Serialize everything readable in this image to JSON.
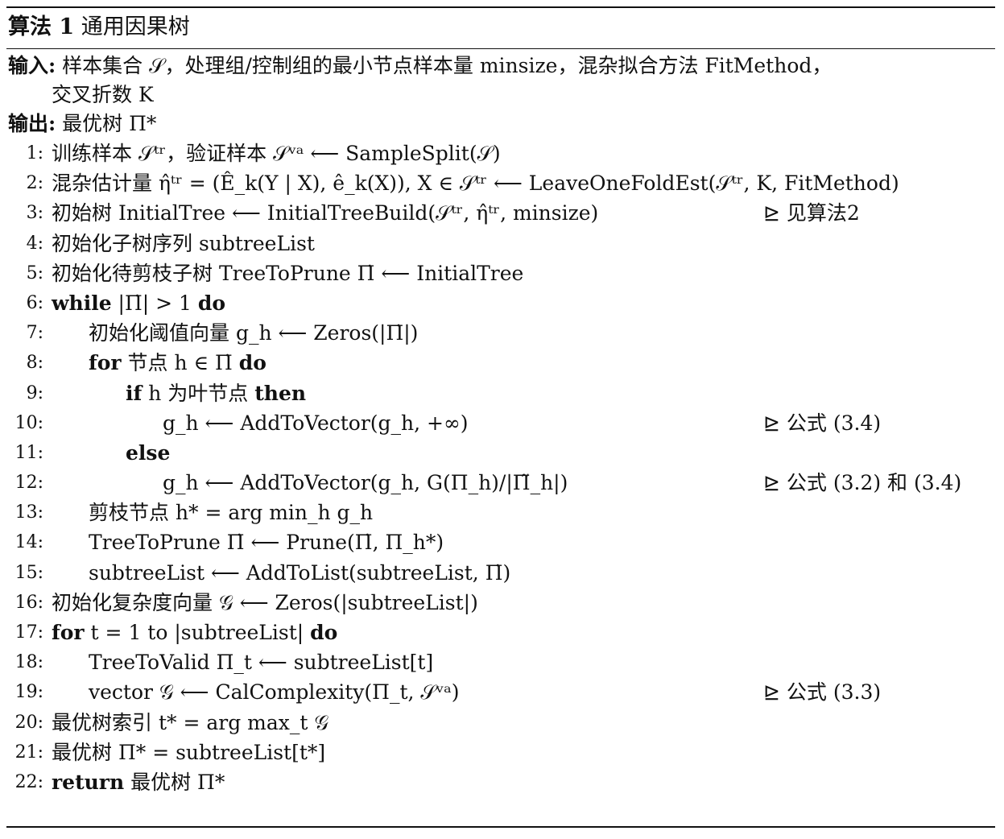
{
  "caption": {
    "label": "算法 1",
    "title": "通用因果树"
  },
  "input": {
    "label": "输入:",
    "text": " 样本集合 𝒮，处理组/控制组的最小节点样本量 minsize，混杂拟合方法 FitMethod，",
    "text_cont": "交叉折数 K"
  },
  "output": {
    "label": "输出:",
    "text": " 最优树 Π*"
  },
  "lines": [
    {
      "num": "1:",
      "indent": 0,
      "kw": "",
      "text": "训练样本 𝒮ᵗʳ，验证样本 𝒮ᵛᵃ ⟵ SampleSplit(𝒮)",
      "comment": ""
    },
    {
      "num": "2:",
      "indent": 0,
      "kw": "",
      "text": "混杂估计量 η̂ᵗʳ = (Ê_k(Y | X), ê_k(X)), X ∈ 𝒮ᵗʳ ⟵ LeaveOneFoldEst(𝒮ᵗʳ, K, FitMethod)",
      "comment": ""
    },
    {
      "num": "3:",
      "indent": 0,
      "kw": "",
      "text": "初始树 InitialTree ⟵ InitialTreeBuild(𝒮ᵗʳ, η̂ᵗʳ, minsize)",
      "comment": "⊵ 见算法2"
    },
    {
      "num": "4:",
      "indent": 0,
      "kw": "",
      "text": "初始化子树序列 subtreeList",
      "comment": ""
    },
    {
      "num": "5:",
      "indent": 0,
      "kw": "",
      "text": "初始化待剪枝子树 TreeToPrune Π̇ ⟵ InitialTree",
      "comment": ""
    },
    {
      "num": "6:",
      "indent": 0,
      "kw": "while",
      "text": " |Π̇| > 1 ",
      "kw2": "do",
      "comment": ""
    },
    {
      "num": "7:",
      "indent": 1,
      "kw": "",
      "text": "初始化阈值向量 g_h ⟵ Zeros(|Π̇|)",
      "comment": ""
    },
    {
      "num": "8:",
      "indent": 1,
      "kw": "for",
      "text": " 节点 h ∈ Π̇ ",
      "kw2": "do",
      "comment": ""
    },
    {
      "num": "9:",
      "indent": 2,
      "kw": "if",
      "text": " h 为叶节点 ",
      "kw2": "then",
      "comment": ""
    },
    {
      "num": "10:",
      "indent": 3,
      "kw": "",
      "text": "g_h ⟵ AddToVector(g_h, +∞)",
      "comment": "⊵ 公式 (3.4)"
    },
    {
      "num": "11:",
      "indent": 2,
      "kw": "else",
      "text": "",
      "comment": ""
    },
    {
      "num": "12:",
      "indent": 3,
      "kw": "",
      "text": "g_h ⟵ AddToVector(g_h, G(Π_h)/|Π̃_h|)",
      "comment": "⊵ 公式 (3.2) 和 (3.4)"
    },
    {
      "num": "13:",
      "indent": 1,
      "kw": "",
      "text": "剪枝节点 h* = arg min_h g_h",
      "comment": ""
    },
    {
      "num": "14:",
      "indent": 1,
      "kw": "",
      "text": "TreeToPrune Π̇ ⟵ Prune(Π̇, Π_h*)",
      "comment": ""
    },
    {
      "num": "15:",
      "indent": 1,
      "kw": "",
      "text": "subtreeList ⟵ AddToList(subtreeList, Π̇)",
      "comment": ""
    },
    {
      "num": "16:",
      "indent": 0,
      "kw": "",
      "text": "初始化复杂度向量 𝒢 ⟵ Zeros(|subtreeList|)",
      "comment": ""
    },
    {
      "num": "17:",
      "indent": 0,
      "kw": "for",
      "text": " t = 1 to |subtreeList| ",
      "kw2": "do",
      "comment": ""
    },
    {
      "num": "18:",
      "indent": 1,
      "kw": "",
      "text": "TreeToValid Π_t ⟵ subtreeList[t]",
      "comment": ""
    },
    {
      "num": "19:",
      "indent": 1,
      "kw": "",
      "text": "vector 𝒢 ⟵ CalComplexity(Π_t, 𝒮ᵛᵃ)",
      "comment": "⊵ 公式 (3.3)"
    },
    {
      "num": "20:",
      "indent": 0,
      "kw": "",
      "text": "最优树索引 t* = arg max_t 𝒢",
      "comment": ""
    },
    {
      "num": "21:",
      "indent": 0,
      "kw": "",
      "text": "最优树 Π* = subtreeList[t*]",
      "comment": ""
    },
    {
      "num": "22:",
      "indent": 0,
      "kw": "return",
      "text": " 最优树 Π*",
      "comment": ""
    }
  ]
}
